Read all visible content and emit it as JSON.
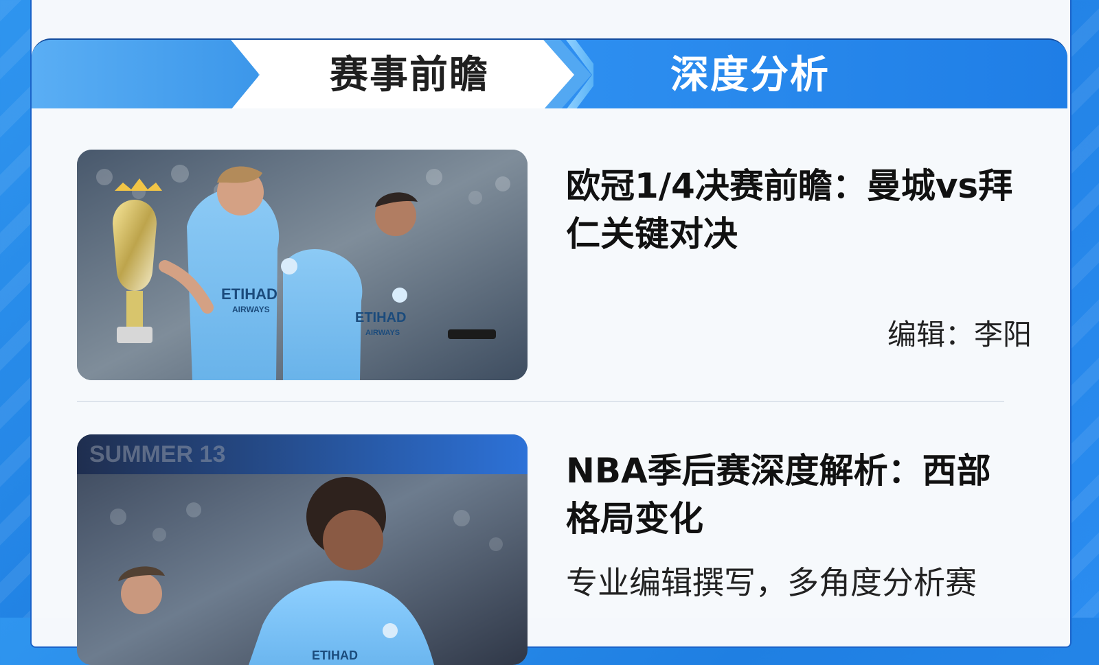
{
  "tabs": {
    "preview_label": "赛事前瞻",
    "analysis_label": "深度分析"
  },
  "articles": [
    {
      "title": "欧冠1/4决赛前瞻：曼城vs拜仁关键对决",
      "editor": "编辑：李阳",
      "image": {
        "caption": "",
        "jersey_text": "ETIHAD",
        "sub_text": "AIRWAYS"
      }
    },
    {
      "title": "NBA季后赛深度解析：西部格局变化",
      "description": "专业编辑撰写，多角度分析赛",
      "image": {
        "caption": "",
        "jersey_text": "ETIHAD",
        "sub_text": "AIRWAYS"
      }
    }
  ],
  "colors": {
    "accent": "#1f7ee6",
    "active_tab": "#ffffff",
    "page_bg": "#f6f9fc",
    "title_text": "#111111"
  }
}
